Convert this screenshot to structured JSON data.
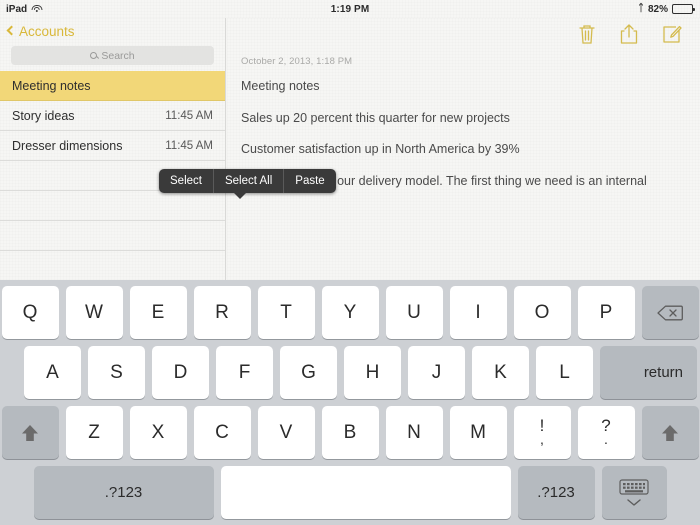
{
  "status_bar": {
    "device": "iPad",
    "wifi_icon": "wifi-icon",
    "time": "1:19 PM",
    "bluetooth_icon": "bluetooth-icon",
    "battery_percent": "82%",
    "battery_level": 82
  },
  "sidebar": {
    "back_label": "Accounts",
    "back_icon": "chevron-left-icon",
    "search": {
      "placeholder": "Search",
      "icon": "search-icon",
      "value": ""
    },
    "notes": [
      {
        "title": "Meeting notes",
        "time": "",
        "selected": true
      },
      {
        "title": "Story ideas",
        "time": "11:45 AM",
        "selected": false
      },
      {
        "title": "Dresser dimensions",
        "time": "11:45 AM",
        "selected": false
      }
    ],
    "empty_row_count": 4
  },
  "detail": {
    "toolbar": [
      {
        "name": "trash-icon",
        "label": "Delete"
      },
      {
        "name": "share-icon",
        "label": "Share"
      },
      {
        "name": "compose-icon",
        "label": "Compose"
      }
    ],
    "date": "October 2, 2013, 1:18 PM",
    "lines": [
      "Meeting notes",
      "Sales up 20 percent this quarter for new projects",
      "Customer satisfaction up in North America by 39%",
      "Ways to improve our delivery model.  The first thing we need is an internal"
    ]
  },
  "edit_popup": {
    "items": [
      "Select",
      "Select All",
      "Paste"
    ]
  },
  "keyboard": {
    "row1": [
      "Q",
      "W",
      "E",
      "R",
      "T",
      "Y",
      "U",
      "I",
      "O",
      "P"
    ],
    "backspace_icon": "backspace-icon",
    "row2": [
      "A",
      "S",
      "D",
      "F",
      "G",
      "H",
      "J",
      "K",
      "L"
    ],
    "return_label": "return",
    "row3": [
      "Z",
      "X",
      "C",
      "V",
      "B",
      "N",
      "M"
    ],
    "punct": [
      {
        "top": "!",
        "bot": ","
      },
      {
        "top": "?",
        "bot": "."
      }
    ],
    "shift_icon": "shift-icon",
    "num_left_label": ".?123",
    "num_right_label": ".?123",
    "space_label": "",
    "dismiss_icon": "dismiss-keyboard-icon"
  },
  "colors": {
    "accent_gold": "#d9b83a",
    "selected_row": "#f2d778",
    "keyboard_bg": "#cdd0d4",
    "key_white": "#ffffff",
    "key_dark": "#b5babf",
    "popup_bg": "#3a3a3a"
  }
}
